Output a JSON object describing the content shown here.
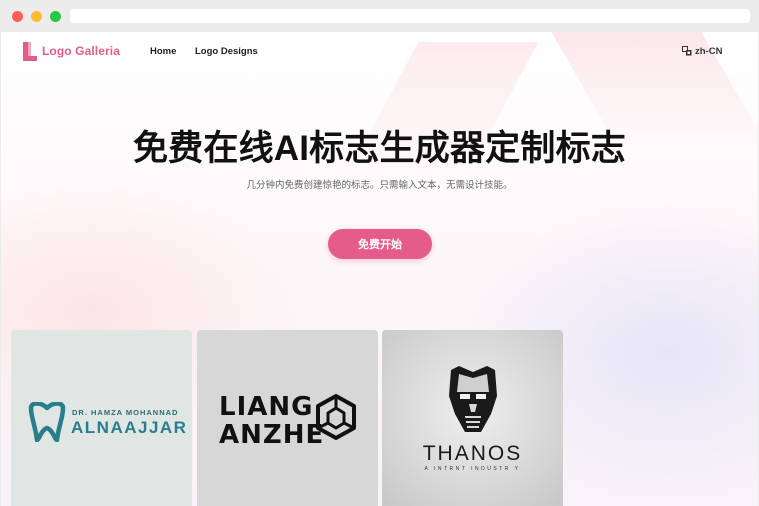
{
  "nav": {
    "brand": "Logo Galleria",
    "links": [
      {
        "label": "Home"
      },
      {
        "label": "Logo Designs"
      }
    ],
    "language": "zh-CN"
  },
  "hero": {
    "title": "免费在线AI标志生成器定制标志",
    "subtitle": "几分钟内免费创建惊艳的标志。只需输入文本，无需设计技能。",
    "cta_label": "免费开始"
  },
  "gallery": [
    {
      "small": "DR. HAMZA MOHANNAD",
      "big": "ALNAAJJAR"
    },
    {
      "line1": "LIANG",
      "line2": "ANZHE"
    },
    {
      "big": "THANOS",
      "small": "A INTRNT INDUSTR Y"
    }
  ],
  "colors": {
    "accent": "#e55b8a",
    "teal": "#2a7e8a"
  },
  "icons": {
    "language": "translate-icon",
    "card1": "tooth-icon",
    "card2": "cube-icon",
    "card3": "mask-icon"
  }
}
